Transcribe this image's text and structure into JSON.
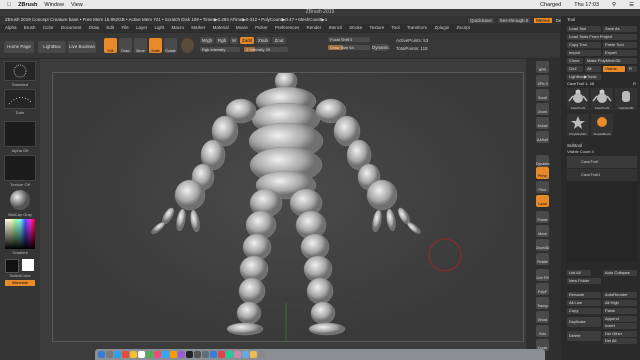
{
  "mac_menu": {
    "app": "ZBrush",
    "window": "Window",
    "view": "View",
    "charged": "Charged",
    "clock1": "Thu 17:03",
    "clock2": "Thu 17:03"
  },
  "title_bar": "ZBrush 2019",
  "info_bar": "ZBrush 2019 Concept Creature base  • Free Mem 15.952GB • Active Mem 721 • Scratch Disk 108 • Timer▶0.284 ATime▶0.312 • PolyCount▶0.47 • MeshCount▶1",
  "menus": [
    "Alpha",
    "Brush",
    "Color",
    "Document",
    "Draw",
    "Edit",
    "File",
    "Layer",
    "Light",
    "Macro",
    "Marker",
    "Material",
    "Movie",
    "Picker",
    "Preferences",
    "Render",
    "Stencil",
    "Stroke",
    "Texture",
    "Tool",
    "Transform",
    "Zplugin",
    "Zscript"
  ],
  "top_right": {
    "quicksave": "QuickSave",
    "see_through": "See-through 0",
    "menus": "Menus",
    "default_zscript": "DefaultZScript"
  },
  "shelf": {
    "home_page": "Home Page",
    "lightbox": "LightBox",
    "live_boolean": "Live Boolean",
    "edit": "Edit",
    "draw": "Draw",
    "move": "Move",
    "scale": "Scale",
    "rotate": "Rotate",
    "mrgb": "Mrgb",
    "rgb": "Rgb",
    "m": "M",
    "zadd": "Zadd",
    "zsub": "Zsub",
    "zcut": "Zcut",
    "rgb_intensity": "Rgb Intensity",
    "z_intensity": "Z Intensity 25",
    "focal_shift": "Focal Shift 0",
    "draw_size": "Draw Size 64",
    "dynamic": "Dynamic",
    "active_points": "ActivePoints: 53",
    "total_points": "TotalPoints: 118"
  },
  "left_panel": {
    "standard": "Standard",
    "dots": "Dots",
    "alpha_off": "Alpha Off",
    "texture_off": "Texture Off",
    "material": "MatCap Gray",
    "gradient": "Gradient",
    "switch_color": "SwitchColor",
    "alternate": "Alternate"
  },
  "right_strip": [
    "BPR",
    "SPix 3",
    "Scroll",
    "Zoom",
    "Actual",
    "AAHalf",
    "Dynamic",
    "Persp",
    "Floor",
    "Local",
    "Frame",
    "Move",
    "Zoom3D",
    "Rotate",
    "Line Fill",
    "PolyF",
    "Transp",
    "Ghost",
    "Solo",
    "Xpose"
  ],
  "tool_panel": {
    "header": "Tool",
    "load_tool": "Load Tool",
    "save_as": "Save As",
    "load_from_project": "Load Tools From Project",
    "copy_tool": "Copy Tool",
    "paste_tool": "Paste Tool",
    "import": "Import",
    "export": "Export",
    "clone": "Clone",
    "make_polymesh": "Make PolyMesh3D",
    "goz": "GoZ",
    "all": "All",
    "visible": "Visible",
    "r": "R",
    "lightbox_tools": "Lightbox▶Tools",
    "current_tool": "CaveTroll 1. 48",
    "tools": [
      "CaveTroll1",
      "CaveTroll1",
      "Cylinder3D",
      "PolyMesh3D",
      "SimpleBrush"
    ],
    "r2": "R",
    "subtool_header": "Subtool",
    "visible_count": "Visible Count 4",
    "subtools": [
      "CaveTroll",
      "CaveTroll1"
    ],
    "list_all": "List All",
    "auto_collapse": "Auto Collapse",
    "new_folder": "New Folder",
    "rename": "Rename",
    "auto_reorder": "AutoReorder",
    "all_low": "All Low",
    "all_high": "All High",
    "copy": "Copy",
    "paste": "Paste",
    "duplicate": "Duplicate",
    "append": "Append",
    "insert": "Insert",
    "delete": "Delete",
    "del_other": "Del Other",
    "del_all": "Del All"
  },
  "accent_color": "#e8892a",
  "progress": {
    "rgb_intensity": 0.0,
    "z_intensity": 0.25,
    "draw_size": 0.35
  }
}
